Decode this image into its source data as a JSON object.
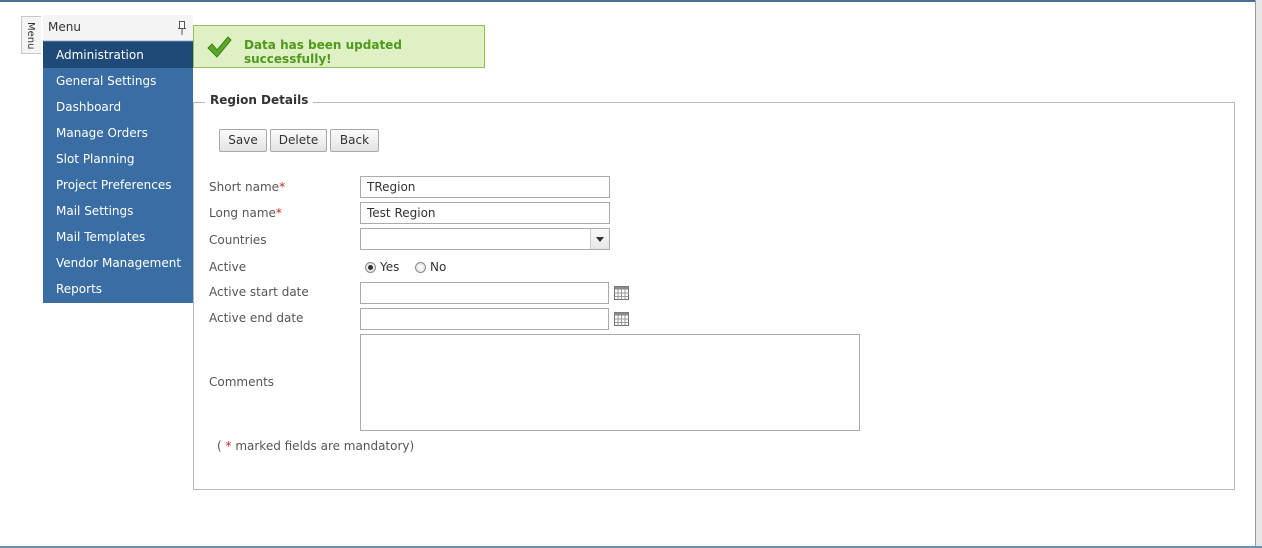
{
  "menu": {
    "tab_label": "Menu",
    "header_title": "Menu",
    "items": [
      {
        "label": "Administration",
        "active": true
      },
      {
        "label": "General Settings"
      },
      {
        "label": "Dashboard"
      },
      {
        "label": "Manage Orders"
      },
      {
        "label": "Slot Planning"
      },
      {
        "label": "Project Preferences"
      },
      {
        "label": "Mail Settings"
      },
      {
        "label": "Mail Templates"
      },
      {
        "label": "Vendor Management"
      },
      {
        "label": "Reports"
      }
    ]
  },
  "notification": {
    "message": "Data has been updated successfully!",
    "color": "#4f9a1d"
  },
  "form": {
    "legend": "Region Details",
    "buttons": {
      "save": "Save",
      "delete": "Delete",
      "back": "Back"
    },
    "fields": {
      "short_name": {
        "label": "Short name",
        "required_mark": "*",
        "value": "TRegion"
      },
      "long_name": {
        "label": "Long name",
        "required_mark": "*",
        "value": "Test Region"
      },
      "countries": {
        "label": "Countries",
        "value": ""
      },
      "active": {
        "label": "Active",
        "yes": "Yes",
        "no": "No",
        "selected": "Yes"
      },
      "active_start_date": {
        "label": "Active start date",
        "value": ""
      },
      "active_end_date": {
        "label": "Active end date",
        "value": ""
      },
      "comments": {
        "label": "Comments",
        "value": ""
      }
    },
    "note": {
      "prefix": "( ",
      "mark": "*",
      "suffix": " marked fields are mandatory)"
    }
  },
  "colors": {
    "menu_bg": "#396da4",
    "menu_active": "#1f4a78",
    "success_bg": "#dff0c4",
    "required": "#cc2222"
  },
  "icons": [
    "pin-icon",
    "check-icon",
    "calendar-icon",
    "chevron-down-icon"
  ]
}
